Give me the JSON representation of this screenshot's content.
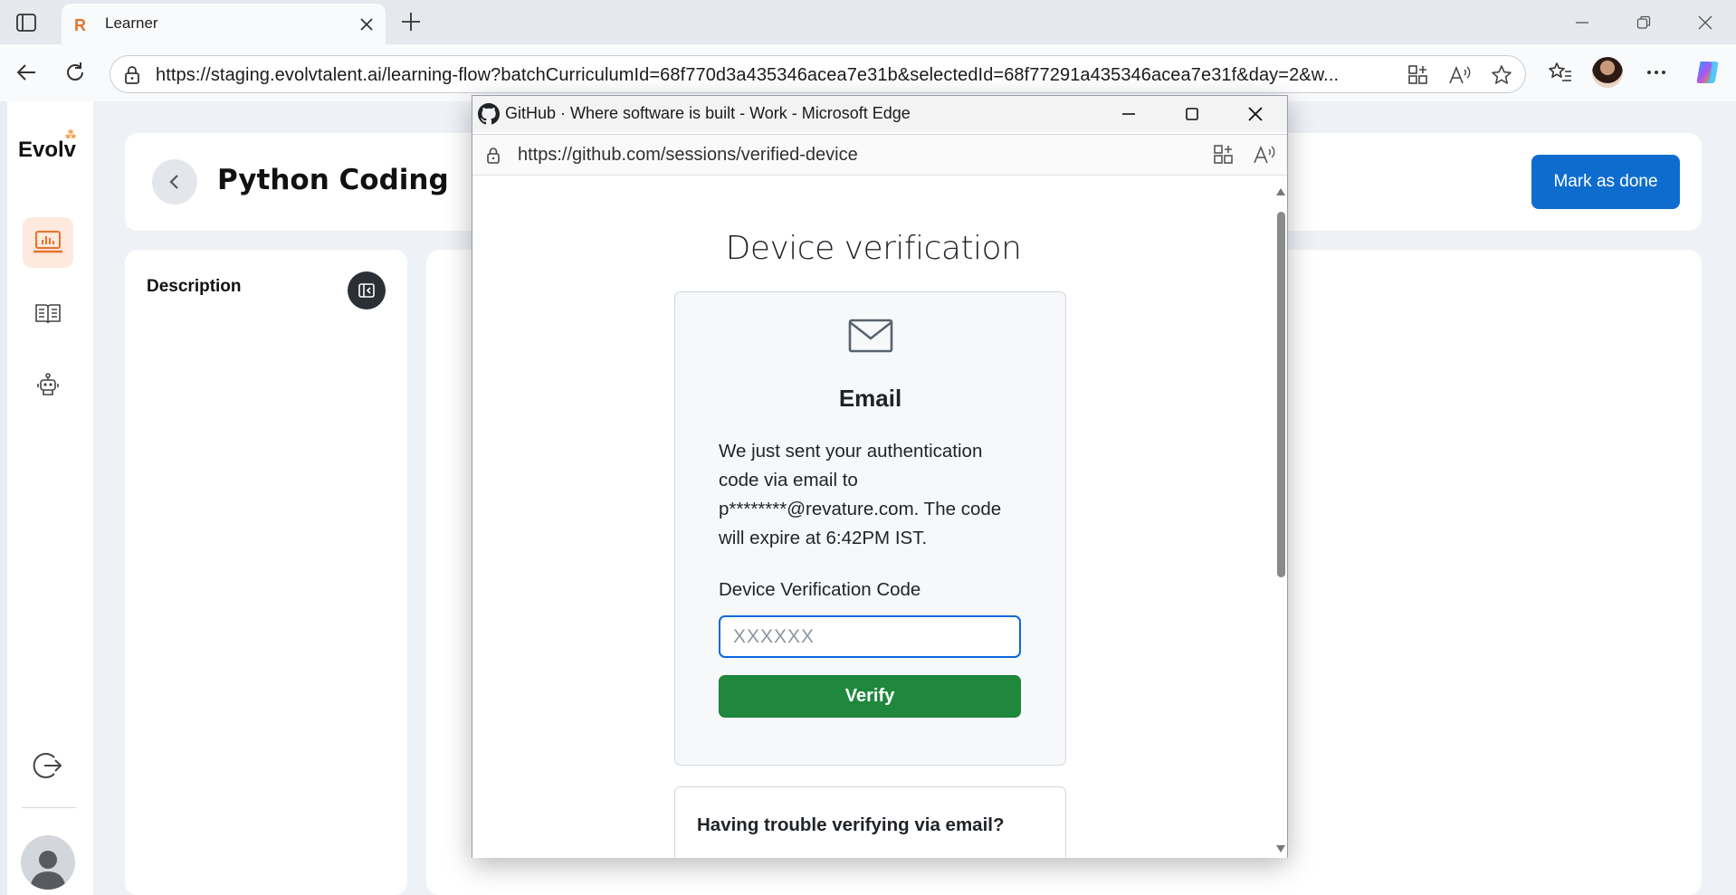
{
  "browser": {
    "tab": {
      "favicon": "R",
      "title": "Learner"
    },
    "address_url": "https://staging.evolvtalent.ai/learning-flow?batchCurriculumId=68f770d3a435346acea7e31b&selectedId=68f77291a435346acea7e31f&day=2&w..."
  },
  "app": {
    "logo": "Evolv",
    "page_title": "Python Coding",
    "mark_done_label": "Mark as done",
    "description_title": "Description",
    "accent_color": "#e8712a"
  },
  "popup": {
    "window_title": "GitHub · Where software is built - Work - Microsoft Edge",
    "url": "https://github.com/sessions/verified-device",
    "heading": "Device verification",
    "method_heading": "Email",
    "message": "We just sent your authentication code via email to p********@revature.com. The code will expire at 6:42PM IST.",
    "code_label": "Device Verification Code",
    "code_placeholder": "XXXXXX",
    "code_value": "",
    "verify_label": "Verify",
    "trouble_text": "Having trouble verifying via email?",
    "verify_button_color": "#1f883d",
    "input_focus_color": "#0969da"
  }
}
